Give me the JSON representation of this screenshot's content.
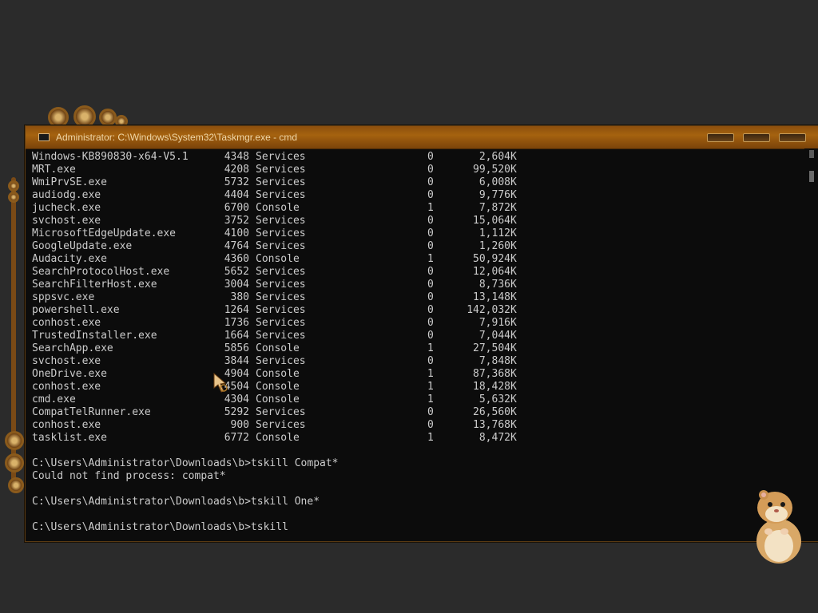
{
  "window": {
    "title": "Administrator: C:\\Windows\\System32\\Taskmgr.exe - cmd"
  },
  "processes": [
    {
      "name": "Windows-KB890830-x64-V5.1",
      "pid": "4348",
      "session": "Services",
      "num": "0",
      "mem": "2,604",
      "unit": "K"
    },
    {
      "name": "MRT.exe",
      "pid": "4208",
      "session": "Services",
      "num": "0",
      "mem": "99,520",
      "unit": "K"
    },
    {
      "name": "WmiPrvSE.exe",
      "pid": "5732",
      "session": "Services",
      "num": "0",
      "mem": "6,008",
      "unit": "K"
    },
    {
      "name": "audiodg.exe",
      "pid": "4404",
      "session": "Services",
      "num": "0",
      "mem": "9,776",
      "unit": "K"
    },
    {
      "name": "jucheck.exe",
      "pid": "6700",
      "session": "Console",
      "num": "1",
      "mem": "7,872",
      "unit": "K"
    },
    {
      "name": "svchost.exe",
      "pid": "3752",
      "session": "Services",
      "num": "0",
      "mem": "15,064",
      "unit": "K"
    },
    {
      "name": "MicrosoftEdgeUpdate.exe",
      "pid": "4100",
      "session": "Services",
      "num": "0",
      "mem": "1,112",
      "unit": "K"
    },
    {
      "name": "GoogleUpdate.exe",
      "pid": "4764",
      "session": "Services",
      "num": "0",
      "mem": "1,260",
      "unit": "K"
    },
    {
      "name": "Audacity.exe",
      "pid": "4360",
      "session": "Console",
      "num": "1",
      "mem": "50,924",
      "unit": "K"
    },
    {
      "name": "SearchProtocolHost.exe",
      "pid": "5652",
      "session": "Services",
      "num": "0",
      "mem": "12,064",
      "unit": "K"
    },
    {
      "name": "SearchFilterHost.exe",
      "pid": "3004",
      "session": "Services",
      "num": "0",
      "mem": "8,736",
      "unit": "K"
    },
    {
      "name": "sppsvc.exe",
      "pid": "380",
      "session": "Services",
      "num": "0",
      "mem": "13,148",
      "unit": "K"
    },
    {
      "name": "powershell.exe",
      "pid": "1264",
      "session": "Services",
      "num": "0",
      "mem": "142,032",
      "unit": "K"
    },
    {
      "name": "conhost.exe",
      "pid": "1736",
      "session": "Services",
      "num": "0",
      "mem": "7,916",
      "unit": "K"
    },
    {
      "name": "TrustedInstaller.exe",
      "pid": "1664",
      "session": "Services",
      "num": "0",
      "mem": "7,044",
      "unit": "K"
    },
    {
      "name": "SearchApp.exe",
      "pid": "5856",
      "session": "Console",
      "num": "1",
      "mem": "27,504",
      "unit": "K"
    },
    {
      "name": "svchost.exe",
      "pid": "3844",
      "session": "Services",
      "num": "0",
      "mem": "7,848",
      "unit": "K"
    },
    {
      "name": "OneDrive.exe",
      "pid": "4904",
      "session": "Console",
      "num": "1",
      "mem": "87,368",
      "unit": "K"
    },
    {
      "name": "conhost.exe",
      "pid": "4504",
      "session": "Console",
      "num": "1",
      "mem": "18,428",
      "unit": "K"
    },
    {
      "name": "cmd.exe",
      "pid": "4304",
      "session": "Console",
      "num": "1",
      "mem": "5,632",
      "unit": "K"
    },
    {
      "name": "CompatTelRunner.exe",
      "pid": "5292",
      "session": "Services",
      "num": "0",
      "mem": "26,560",
      "unit": "K"
    },
    {
      "name": "conhost.exe",
      "pid": "900",
      "session": "Services",
      "num": "0",
      "mem": "13,768",
      "unit": "K"
    },
    {
      "name": "tasklist.exe",
      "pid": "6772",
      "session": "Console",
      "num": "1",
      "mem": "8,472",
      "unit": "K"
    }
  ],
  "commands": [
    "C:\\Users\\Administrator\\Downloads\\b>tskill Compat*",
    "Could not find process: compat*",
    "C:\\Users\\Administrator\\Downloads\\b>tskill One*",
    "C:\\Users\\Administrator\\Downloads\\b>tskill"
  ],
  "colors": {
    "titlebar": "#a5620f",
    "console_bg": "#0c0c0c",
    "console_text": "#cccccc",
    "desktop": "#2b2b2b"
  },
  "icons": {
    "title": "console-icon",
    "cursor": "mouse-pointer-icon",
    "mascot": "hamster-mascot"
  }
}
